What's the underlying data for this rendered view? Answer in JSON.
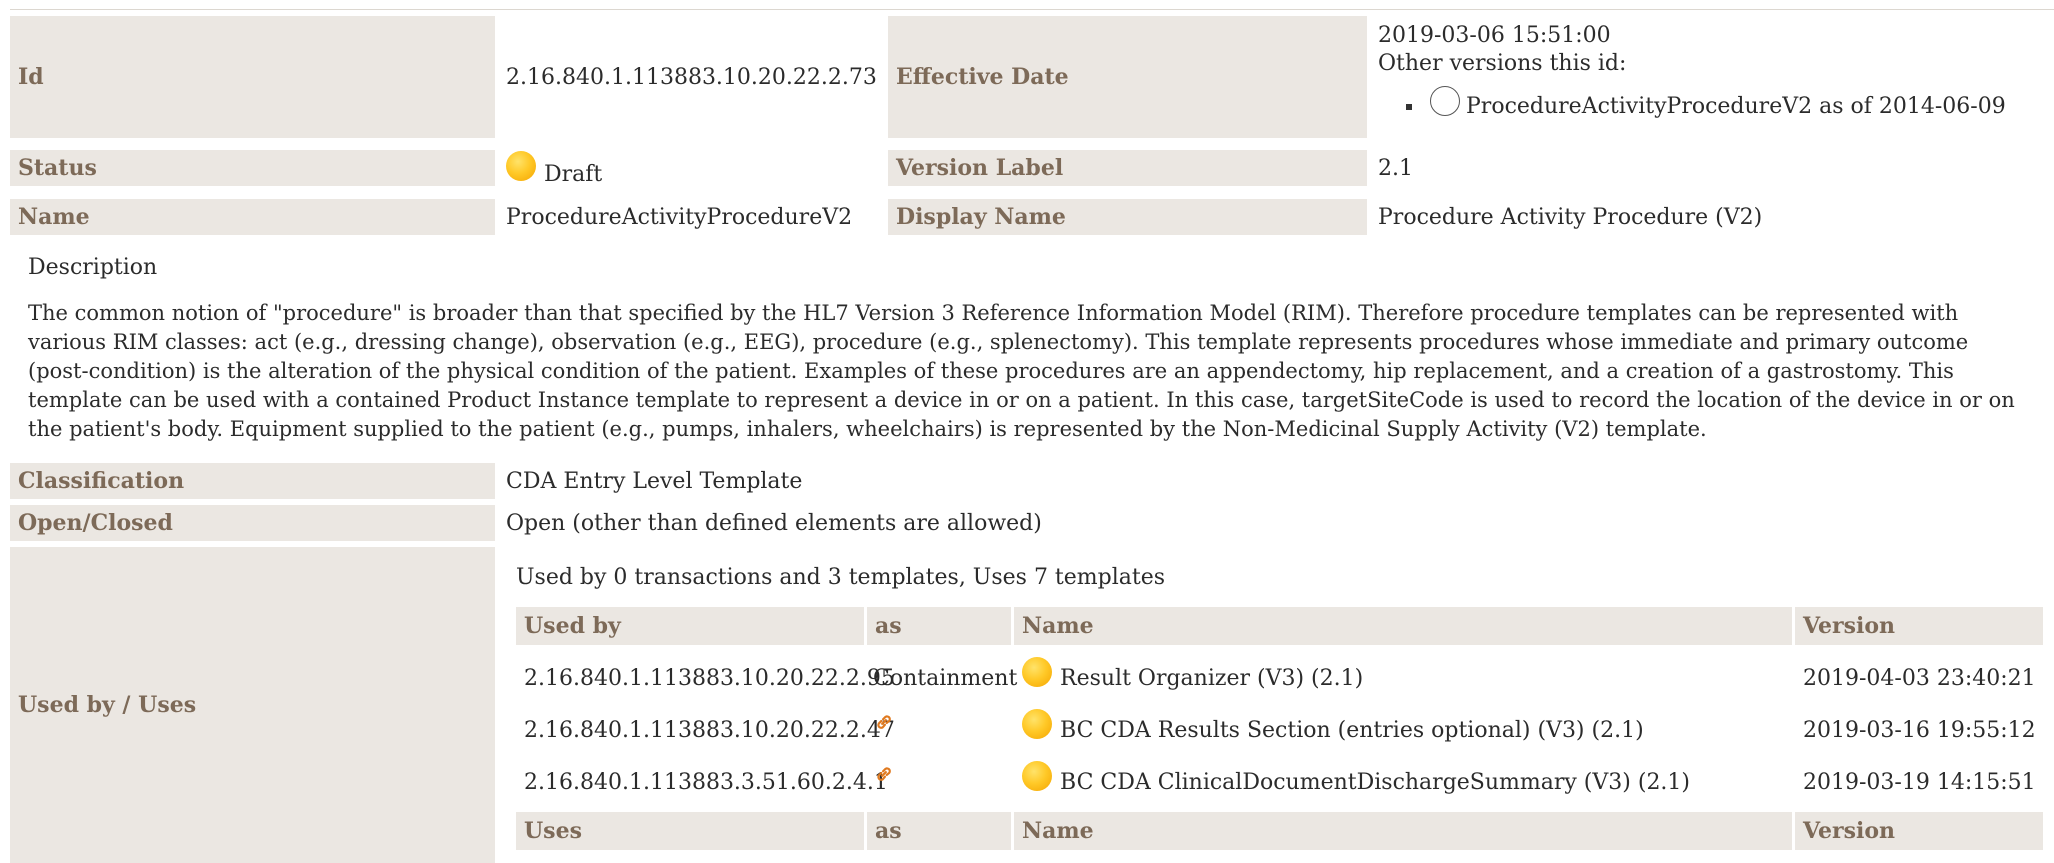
{
  "header": {
    "id_label": "Id",
    "id_value": "2.16.840.1.113883.10.20.22.2.73",
    "effective_date_label": "Effective Date",
    "effective_date_value": "2019-03-06 15:51:00",
    "other_versions_label": "Other versions this id:",
    "other_versions": [
      {
        "label": "ProcedureActivityProcedureV2 as of 2014-06-09"
      }
    ],
    "status_label": "Status",
    "status_value": "Draft",
    "version_label_label": "Version Label",
    "version_label_value": "2.1",
    "name_label": "Name",
    "name_value": "ProcedureActivityProcedureV2",
    "display_name_label": "Display Name",
    "display_name_value": "Procedure Activity Procedure (V2)"
  },
  "description": {
    "title": "Description",
    "text": "The common notion of \"procedure\" is broader than that specified by the HL7 Version 3 Reference Information Model (RIM). Therefore procedure templates can be represented with various RIM classes: act (e.g., dressing change), observation (e.g., EEG), procedure (e.g., splenectomy). This template represents procedures whose immediate and primary outcome (post-condition) is the alteration of the physical condition of the patient. Examples of these procedures are an appendectomy, hip replacement, and a creation of a gastrostomy. This template can be used with a contained Product Instance template to represent a device in or on a patient. In this case, targetSiteCode is used to record the location of the device in or on the patient's body. Equipment supplied to the patient (e.g., pumps, inhalers, wheelchairs) is represented by the Non-Medicinal Supply Activity (V2) template."
  },
  "classification": {
    "label": "Classification",
    "value": "CDA Entry Level Template"
  },
  "open_closed": {
    "label": "Open/Closed",
    "value": "Open (other than defined elements are allowed)"
  },
  "used_by_uses": {
    "label": "Used by / Uses",
    "summary": "Used by 0 transactions and 3 templates, Uses 7 templates",
    "used_by_headers": [
      "Used by",
      "as",
      "Name",
      "Version"
    ],
    "used_by_rows": [
      {
        "id": "2.16.840.1.113883.10.20.22.2.95",
        "as": "Containment",
        "as_icon": "",
        "name": "Result Organizer (V3) (2.1)",
        "version": "2019-04-03 23:40:21"
      },
      {
        "id": "2.16.840.1.113883.10.20.22.2.47",
        "as": "",
        "as_icon": "link-icon",
        "name": "BC CDA Results Section (entries optional) (V3) (2.1)",
        "version": "2019-03-16 19:55:12"
      },
      {
        "id": "2.16.840.1.113883.3.51.60.2.4.1",
        "as": "",
        "as_icon": "link-icon",
        "name": "BC CDA ClinicalDocumentDischargeSummary (V3) (2.1)",
        "version": "2019-03-19 14:15:51"
      }
    ],
    "uses_headers": [
      "Uses",
      "as",
      "Name",
      "Version"
    ]
  },
  "colors": {
    "label_bg": "#ebe7e2",
    "label_text": "#7d6a58",
    "status_draft": "#ffc928",
    "link_icon": "#e07a20"
  }
}
